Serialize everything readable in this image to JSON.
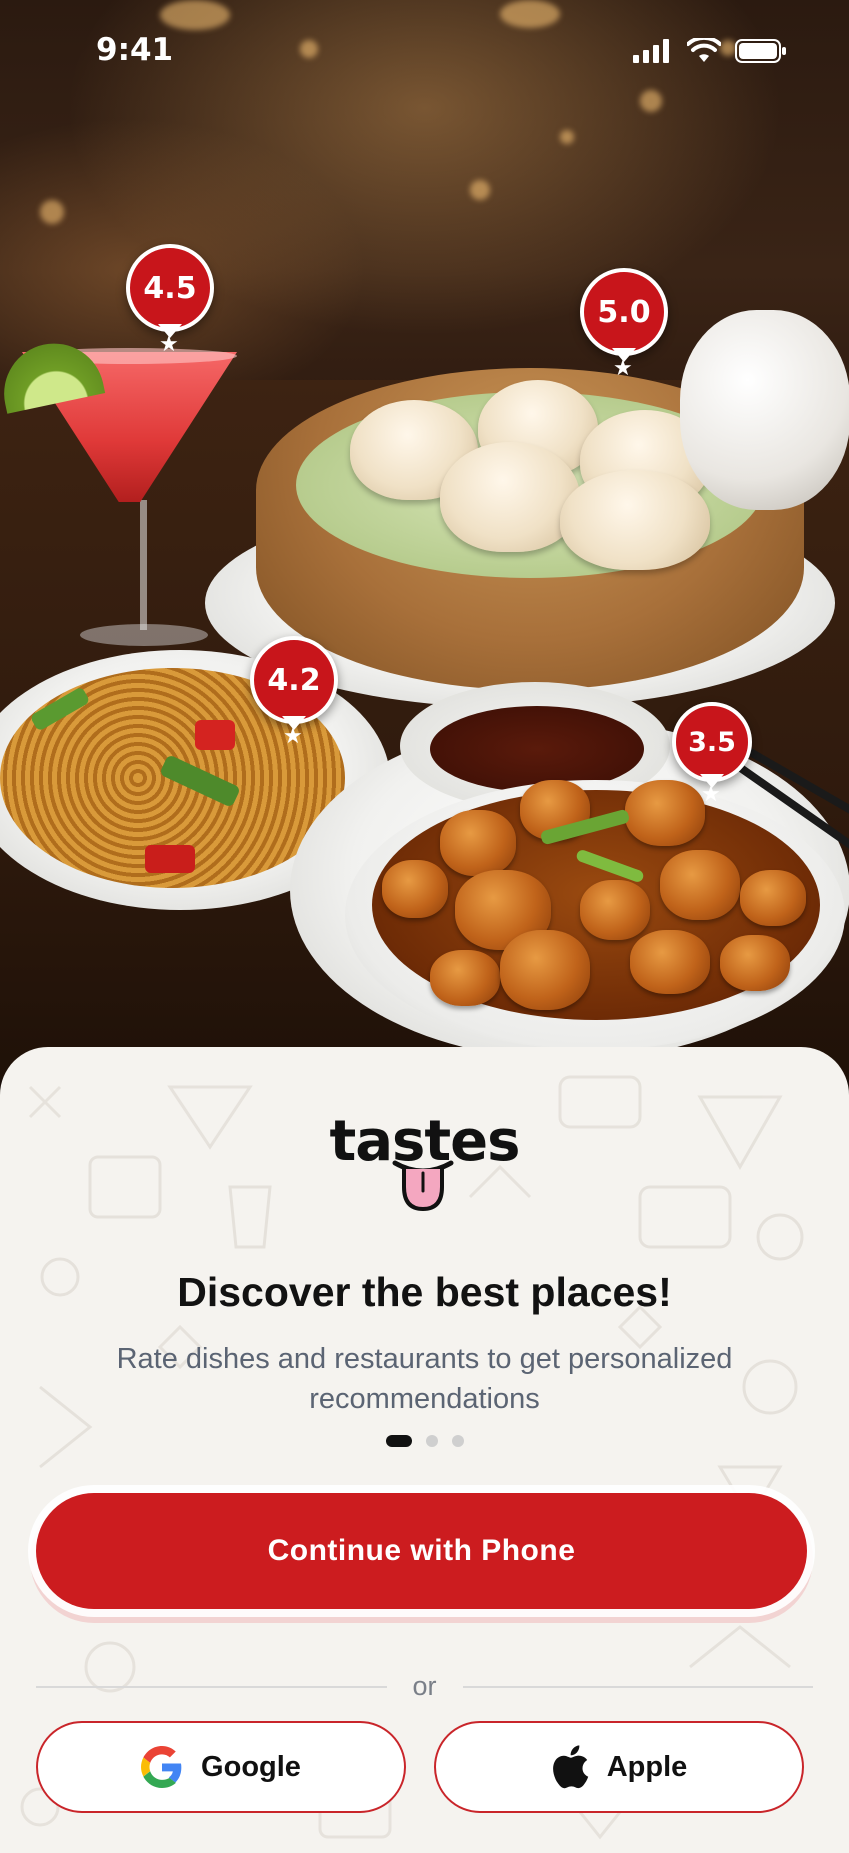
{
  "status_bar": {
    "time": "9:41"
  },
  "ratings": [
    {
      "value": "4.5",
      "dish": "cocktail"
    },
    {
      "value": "5.0",
      "dish": "dumplings"
    },
    {
      "value": "4.2",
      "dish": "noodles"
    },
    {
      "value": "3.5",
      "dish": "chicken"
    }
  ],
  "brand": {
    "name": "tastes"
  },
  "onboarding": {
    "title": "Discover the best places!",
    "subtitle": "Rate dishes and restaurants to get personalized recommendations",
    "page_indicator": {
      "total": 3,
      "active": 1
    }
  },
  "actions": {
    "primary_label": "Continue with Phone",
    "divider_label": "or",
    "google_label": "Google",
    "apple_label": "Apple"
  },
  "colors": {
    "accent": "#cc1c1f",
    "sheet_bg": "#f5f3ef",
    "pin": "#c8151b"
  }
}
